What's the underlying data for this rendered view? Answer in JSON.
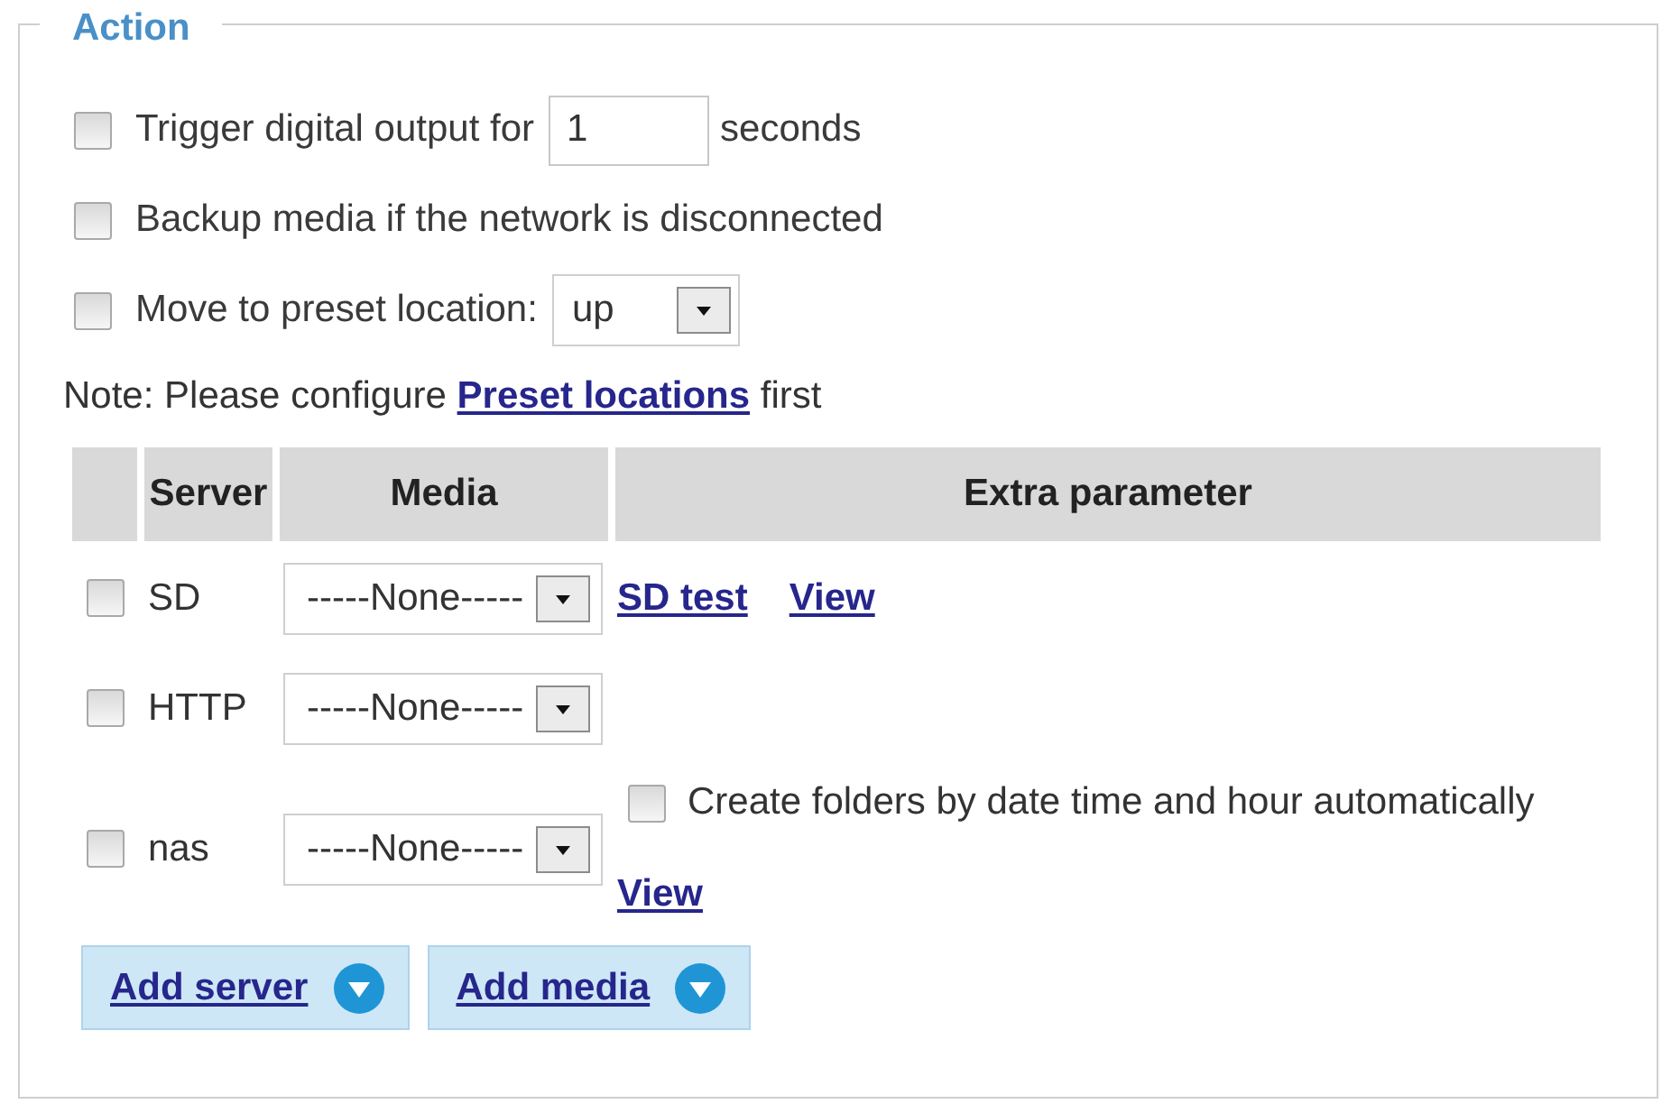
{
  "fieldset": {
    "legend": "Action"
  },
  "options": [
    {
      "kind": "input",
      "checked": false,
      "label": "Trigger digital output for",
      "value": "1",
      "unit": "seconds"
    },
    {
      "kind": "plain",
      "checked": false,
      "label": "Backup media if the network is disconnected"
    },
    {
      "kind": "select",
      "checked": false,
      "label": "Move to preset location:",
      "value": "up"
    }
  ],
  "note": {
    "text": "Note: Please configure",
    "link": "Preset locations",
    "after": "first"
  },
  "table": {
    "columns": [
      "Server",
      "Media",
      "Extra parameter"
    ],
    "rows": [
      {
        "checked": false,
        "server": "SD",
        "media": "-----None-----",
        "extra": [
          {
            "kind": "link",
            "text": "SD test"
          },
          {
            "kind": "link",
            "text": "View"
          }
        ]
      },
      {
        "checked": false,
        "server": "HTTP",
        "media": "-----None-----"
      },
      {
        "checked": false,
        "server": "nas",
        "media": "-----None-----",
        "extra": [
          {
            "kind": "checkbox",
            "checked": false,
            "label": "Create folders by date time and hour automatically"
          },
          {
            "kind": "link",
            "text": "View"
          }
        ]
      }
    ]
  },
  "buttons": [
    "Add server",
    "Add media"
  ]
}
